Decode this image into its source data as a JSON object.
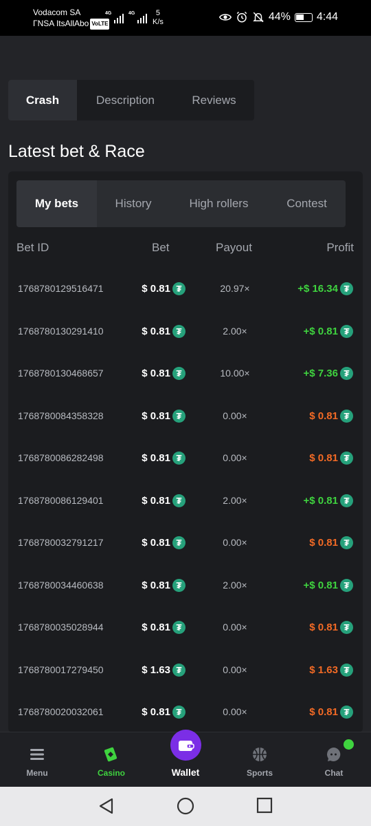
{
  "status_bar": {
    "carrier_line1": "Vodacom SA",
    "carrier_line2": "ΓNSA ItsAllAbo",
    "volte": "VoLTE",
    "net_tag": "4G",
    "speed_value": "5",
    "speed_unit": "K/s",
    "battery": "44%",
    "time": "4:44"
  },
  "product_tabs": [
    {
      "label": "Crash",
      "active": true
    },
    {
      "label": "Description",
      "active": false
    },
    {
      "label": "Reviews",
      "active": false
    }
  ],
  "section_title": "Latest bet & Race",
  "bet_tabs": [
    {
      "label": "My bets",
      "active": true
    },
    {
      "label": "History",
      "active": false
    },
    {
      "label": "High rollers",
      "active": false
    },
    {
      "label": "Contest",
      "active": false
    }
  ],
  "table": {
    "headers": {
      "bet_id": "Bet ID",
      "bet": "Bet",
      "payout": "Payout",
      "profit": "Profit"
    },
    "currency_icon": "tether-icon",
    "rows": [
      {
        "id": "1768780129516471",
        "bet": "$ 0.81",
        "payout": "20.97×",
        "profit": "+$ 16.34",
        "result": "win"
      },
      {
        "id": "1768780130291410",
        "bet": "$ 0.81",
        "payout": "2.00×",
        "profit": "+$ 0.81",
        "result": "win"
      },
      {
        "id": "1768780130468657",
        "bet": "$ 0.81",
        "payout": "10.00×",
        "profit": "+$ 7.36",
        "result": "win"
      },
      {
        "id": "1768780084358328",
        "bet": "$ 0.81",
        "payout": "0.00×",
        "profit": "$ 0.81",
        "result": "loss"
      },
      {
        "id": "1768780086282498",
        "bet": "$ 0.81",
        "payout": "0.00×",
        "profit": "$ 0.81",
        "result": "loss"
      },
      {
        "id": "1768780086129401",
        "bet": "$ 0.81",
        "payout": "2.00×",
        "profit": "+$ 0.81",
        "result": "win"
      },
      {
        "id": "1768780032791217",
        "bet": "$ 0.81",
        "payout": "0.00×",
        "profit": "$ 0.81",
        "result": "loss"
      },
      {
        "id": "1768780034460638",
        "bet": "$ 0.81",
        "payout": "2.00×",
        "profit": "+$ 0.81",
        "result": "win"
      },
      {
        "id": "1768780035028944",
        "bet": "$ 0.81",
        "payout": "0.00×",
        "profit": "$ 0.81",
        "result": "loss"
      },
      {
        "id": "1768780017279450",
        "bet": "$ 1.63",
        "payout": "0.00×",
        "profit": "$ 1.63",
        "result": "loss"
      },
      {
        "id": "1768780020032061",
        "bet": "$ 0.81",
        "payout": "0.00×",
        "profit": "$ 0.81",
        "result": "loss"
      }
    ]
  },
  "bottom_nav": {
    "menu": "Menu",
    "casino": "Casino",
    "wallet": "Wallet",
    "sports": "Sports",
    "chat": "Chat"
  },
  "colors": {
    "background": "#232428",
    "panel": "#1b1c1f",
    "win": "#3fd33f",
    "loss": "#f26a25",
    "wallet_accent": "#7b2ee6",
    "tether": "#26a17b"
  }
}
